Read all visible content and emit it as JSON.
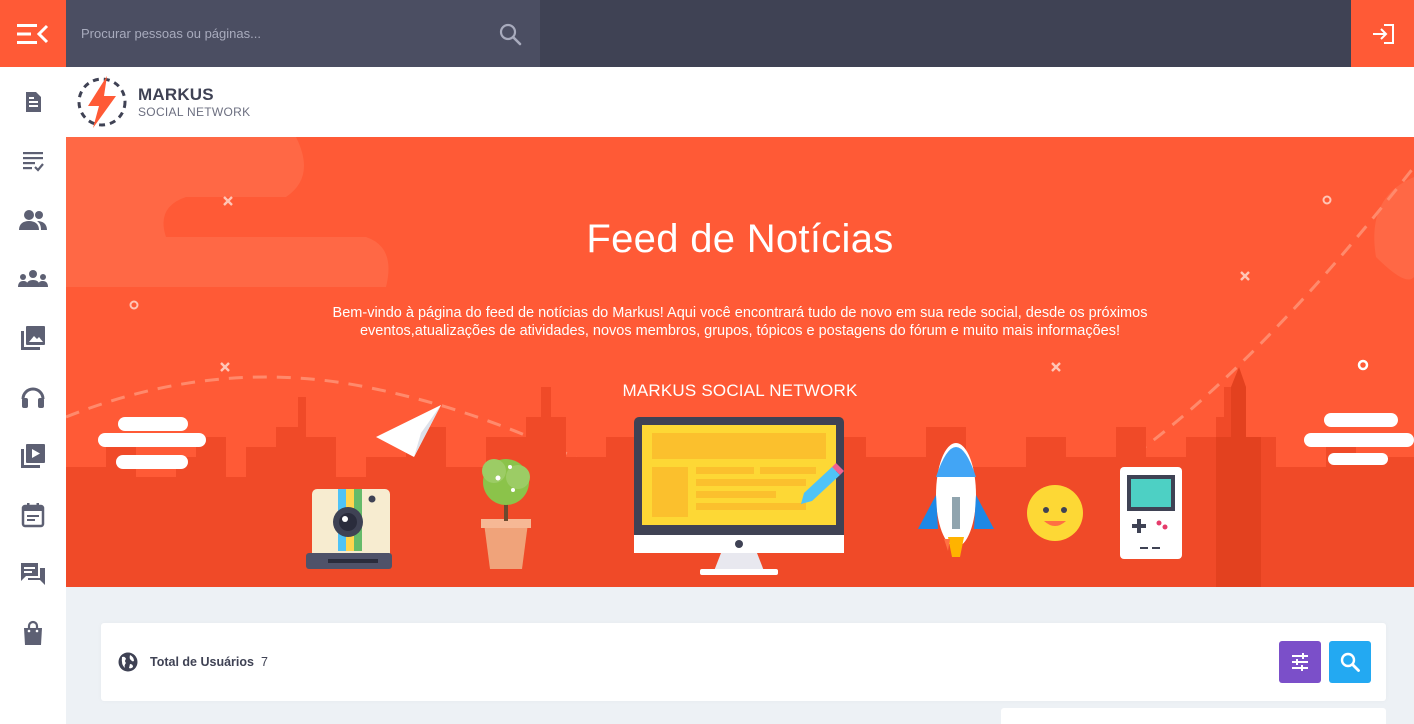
{
  "topbar": {
    "search_placeholder": "Procurar pessoas ou páginas...",
    "menu_icon": "menu-collapse-icon",
    "search_icon": "search-icon",
    "login_icon": "login-icon"
  },
  "sidebar": {
    "items": [
      {
        "icon": "newsfeed-icon"
      },
      {
        "icon": "checklist-icon"
      },
      {
        "icon": "people-icon"
      },
      {
        "icon": "groups-icon"
      },
      {
        "icon": "photos-icon"
      },
      {
        "icon": "headphones-icon"
      },
      {
        "icon": "videos-icon"
      },
      {
        "icon": "calendar-icon"
      },
      {
        "icon": "forum-icon"
      },
      {
        "icon": "shopping-bag-icon"
      }
    ]
  },
  "brand": {
    "title": "MARKUS",
    "subtitle": "SOCIAL NETWORK"
  },
  "banner": {
    "title": "Feed de Notícias",
    "description": "Bem-vindo à página do feed de notícias do Markus! Aqui você encontrará tudo de novo em sua rede social, desde os próximos eventos,atualizações de atividades, novos membros, grupos, tópicos e postagens do fórum e muito mais informações!",
    "tagline": "MARKUS SOCIAL NETWORK"
  },
  "stats": {
    "label": "Total de Usuários",
    "count": "7"
  },
  "colors": {
    "accent": "#ff5a36",
    "topbar": "#3f4254",
    "filter_button": "#7b4fc9",
    "search_button": "#23a9f2"
  }
}
